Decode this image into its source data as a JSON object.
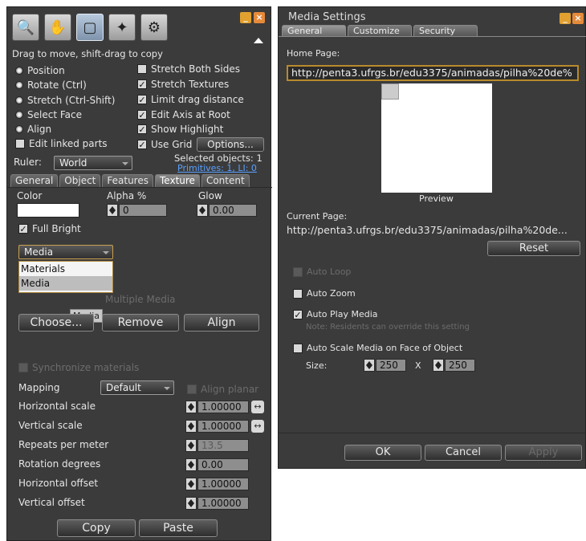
{
  "build": {
    "tools": [
      "zoom-icon",
      "grab-hand-icon",
      "edit-cube-icon",
      "create-wand-icon",
      "land-bulldozer-icon"
    ],
    "hint": "Drag to move, shift-drag to copy",
    "radios": [
      "Position",
      "Rotate (Ctrl)",
      "Stretch (Ctrl-Shift)",
      "Select Face",
      "Align"
    ],
    "edit_linked": "Edit linked parts",
    "checks": [
      "Stretch Both Sides",
      "Stretch Textures",
      "Limit drag distance",
      "Edit Axis at Root",
      "Show Highlight",
      "Use Grid"
    ],
    "options_label": "Options...",
    "ruler_label": "Ruler:",
    "ruler_value": "World",
    "selected_objects": "Selected objects: 1",
    "primitives": "Primitives: 1, LI: 0",
    "tabs": [
      "General",
      "Object",
      "Features",
      "Texture",
      "Content"
    ],
    "color_label": "Color",
    "alpha_label": "Alpha %",
    "alpha_value": "0",
    "glow_label": "Glow",
    "glow_value": "0.00",
    "full_bright": "Full Bright",
    "media_select": "Media",
    "dropdown_items": [
      "Materials",
      "Media"
    ],
    "multiple_media": "Multiple Media",
    "tooltip": "Media",
    "choose_label": "Choose...",
    "remove_label": "Remove",
    "align_label": "Align",
    "sync_materials": "Synchronize materials",
    "mapping_label": "Mapping",
    "mapping_value": "Default",
    "align_planar": "Align planar",
    "rows": [
      {
        "label": "Horizontal scale",
        "value": "1.00000"
      },
      {
        "label": "Vertical scale",
        "value": "1.00000"
      },
      {
        "label": "Repeats per meter",
        "value": "13.5"
      },
      {
        "label": "Rotation degrees",
        "value": "0.00"
      },
      {
        "label": "Horizontal offset",
        "value": "1.00000"
      },
      {
        "label": "Vertical offset",
        "value": "1.00000"
      }
    ],
    "copy_label": "Copy",
    "paste_label": "Paste"
  },
  "media": {
    "title": "Media Settings",
    "tabs": [
      "General",
      "Customize",
      "Security"
    ],
    "home_page_label": "Home Page:",
    "home_page_url": "http://penta3.ufrgs.br/edu3375/animadas/pilha%20de%",
    "preview_label": "Preview",
    "current_page_label": "Current Page:",
    "current_page_url": "http://penta3.ufrgs.br/edu3375/animadas/pilha%20de...",
    "reset_label": "Reset",
    "auto_loop": "Auto Loop",
    "auto_zoom": "Auto Zoom",
    "auto_play": "Auto Play Media",
    "auto_play_note": "Note: Residents can override this setting",
    "auto_scale": "Auto Scale Media on Face of Object",
    "size_label": "Size:",
    "size_w": "250",
    "size_x": "X",
    "size_h": "250",
    "ok_label": "OK",
    "cancel_label": "Cancel",
    "apply_label": "Apply"
  }
}
